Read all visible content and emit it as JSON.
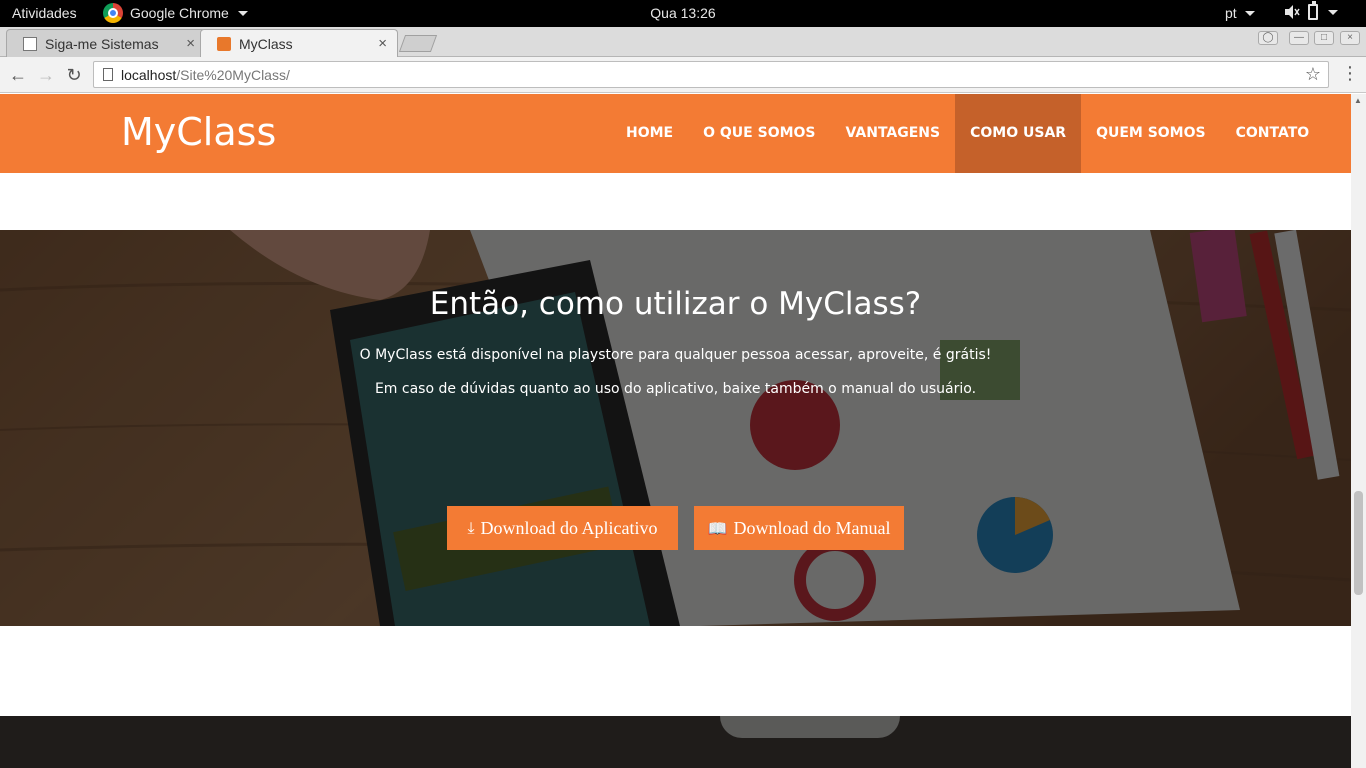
{
  "system_bar": {
    "activities": "Atividades",
    "app_name": "Google Chrome",
    "clock": "Qua 13:26",
    "language": "pt"
  },
  "browser": {
    "tabs": [
      {
        "title": "Siga-me Sistemas",
        "close": "×"
      },
      {
        "title": "MyClass",
        "close": "×"
      }
    ],
    "url_host": "localhost",
    "url_path": "/Site%20MyClass/",
    "back": "←",
    "forward": "→",
    "reload": "↻",
    "bookmark": "☆",
    "menu": "⋮"
  },
  "site": {
    "brand": "MyClass",
    "menu": [
      {
        "label": "HOME"
      },
      {
        "label": "O QUE SOMOS"
      },
      {
        "label": "VANTAGENS"
      },
      {
        "label": "COMO USAR"
      },
      {
        "label": "QUEM SOMOS"
      },
      {
        "label": "CONTATO"
      }
    ],
    "active_menu": "COMO USAR",
    "accent_color": "#f37b34"
  },
  "hero": {
    "title": "Então, como utilizar o MyClass?",
    "line1": "O MyClass está disponível na playstore para qualquer pessoa acessar, aproveite, é grátis!",
    "line2": "Em caso de dúvidas quanto ao uso do aplicativo, baixe também o manual do usuário.",
    "btn_app": "Download do Aplicativo",
    "btn_manual": "Download do Manual",
    "btn_app_icon": "download-icon",
    "btn_manual_icon": "book-icon"
  }
}
